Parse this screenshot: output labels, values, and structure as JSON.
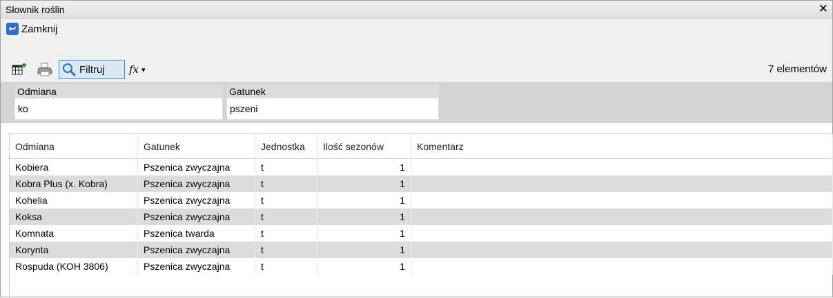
{
  "window": {
    "title": "Słownik roślin",
    "close_glyph": "✕"
  },
  "closebar": {
    "label": "Zamknij",
    "icon": "back-arrow-icon"
  },
  "toolbar": {
    "filter_label": "Filtruj",
    "fx_label": "fx",
    "fx_dropdown": "▾",
    "count_text": "7 elementów"
  },
  "filters": {
    "odmiana_label": "Odmiana",
    "odmiana_value": "ko",
    "gatunek_label": "Gatunek",
    "gatunek_value": "pszeni"
  },
  "grid": {
    "headers": [
      "Odmiana",
      "Gatunek",
      "Jednostka",
      "Ilość sezonów",
      "Komentarz"
    ],
    "rows": [
      [
        "Kobiera",
        "Pszenica zwyczajna",
        "t",
        "1",
        ""
      ],
      [
        "Kobra Plus (x. Kobra)",
        "Pszenica zwyczajna",
        "t",
        "1",
        ""
      ],
      [
        "Kohelia",
        "Pszenica zwyczajna",
        "t",
        "1",
        ""
      ],
      [
        "Koksa",
        "Pszenica zwyczajna",
        "t",
        "1",
        ""
      ],
      [
        "Komnata",
        "Pszenica twarda",
        "t",
        "1",
        ""
      ],
      [
        "Korynta",
        "Pszenica zwyczajna",
        "t",
        "1",
        ""
      ],
      [
        "Rospuda (KOH 3806)",
        "Pszenica zwyczajna",
        "t",
        "1",
        ""
      ]
    ]
  }
}
